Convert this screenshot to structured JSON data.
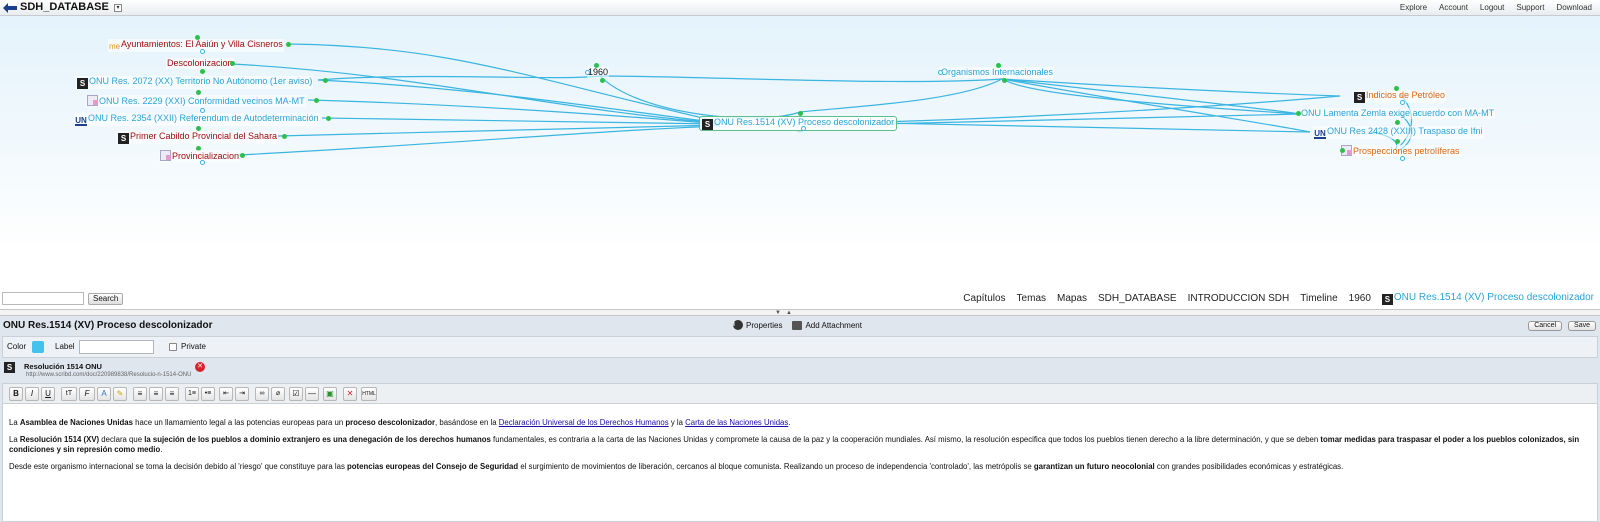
{
  "app": {
    "title": "SDH_DATABASE",
    "dropdown_glyph": "▾"
  },
  "topnav": [
    "Explore",
    "Account",
    "Logout",
    "Support",
    "Download"
  ],
  "graph": {
    "nodes": {
      "ayuntamientos": {
        "prefix": "me",
        "label": "Ayuntamientos: El Aaiún y Villa Cisneros"
      },
      "descolonizacion": {
        "label": "Descolonizacion"
      },
      "onu2072": {
        "label": "ONU Res. 2072 (XX) Territorio No Autónomo (1er aviso)"
      },
      "onu2229": {
        "label": "ONU Res. 2229 (XXI) Conformidad vecinos MA-MT"
      },
      "onu2354": {
        "label": "ONU Res. 2354 (XXII) Referendum de Autodeterminación"
      },
      "cabildo": {
        "label": "Primer Cabildo Provincial del Sahara"
      },
      "provincializacion": {
        "label": "Provincializacion"
      },
      "y1960": {
        "label": "1960"
      },
      "organismos": {
        "label": "Organismos Internacionales"
      },
      "center": {
        "label": "ONU Res.1514 (XV) Proceso descolonizador"
      },
      "indicios": {
        "label": "Indicios de Petróleo"
      },
      "lamenta": {
        "label": "ONU Lamenta Zemla exige acuerdo con MA-MT"
      },
      "onu2428": {
        "label": "ONU Res 2428 (XXIII) Traspaso de Ifni"
      },
      "prospecciones": {
        "label": "Prospecciones petrolíferas"
      }
    }
  },
  "search": {
    "placeholder": "",
    "button": "Search"
  },
  "breadcrumbs": [
    "Capítulos",
    "Temas",
    "Mapas",
    "SDH_DATABASE",
    "INTRODUCCION SDH",
    "Timeline",
    "1960",
    "ONU Res.1514 (XV) Proceso descolonizador"
  ],
  "panel": {
    "title": "ONU Res.1514 (XV) Proceso descolonizador",
    "tabs": {
      "properties": "Properties",
      "attachment": "Add Attachment"
    },
    "cancel": "Cancel",
    "save": "Save",
    "color_label": "Color",
    "color_value": "#44c1ec",
    "label_label": "Label",
    "label_value": "",
    "private_label": "Private"
  },
  "attachment": {
    "title": "Resolución 1514 ONU",
    "url": "http://www.scribd.com/doc/220989838/Resolucio-n-1514-ONU"
  },
  "editor_toolbar": [
    "bold",
    "italic",
    "underline",
    "font-size",
    "font-family",
    "text-color",
    "highlight",
    "align-left",
    "align-center",
    "align-right",
    "ordered-list",
    "unordered-list",
    "outdent",
    "indent",
    "link",
    "unlink",
    "checkbox",
    "horizontal-rule",
    "image",
    "remove",
    "html"
  ],
  "editor": {
    "p1": {
      "t1": "La ",
      "b1": "Asamblea de Naciones Unidas",
      "t2": " hace un llamamiento legal a las potencias europeas para un ",
      "b2": "proceso descolonizador",
      "t3": ", basándose en la ",
      "link1": "Declaración Universal de los Derechos Humanos",
      "t4": " y la ",
      "link2": "Carta de las Naciones Unidas",
      "t5": "."
    },
    "p2": {
      "t1": "La ",
      "b1": "Resolución 1514 (XV)",
      "t2": " declara que ",
      "b2": "la sujeción de los pueblos a dominio extranjero es una denegación de los derechos humanos",
      "t3": " fundamentales, es contraria a la carta de las Naciones Unidas y compromete la causa de la paz y la cooperación mundiales. Así mismo, la resolución especifica que todos los pueblos tienen derecho a la libre determinación, y que se deben ",
      "b3": "tomar medidas para traspasar el poder a los pueblos colonizados, sin condiciones y sin represión como medio",
      "t4": "."
    },
    "p3": {
      "t1": "Desde este organismo internacional se toma la decisión debido al 'riesgo' que constituye para las ",
      "b1": "potencias europeas del Consejo de Seguridad",
      "t2": " el surgimiento de movimientos de liberación, cercanos al bloque comunista. Realizando un proceso de independencia 'controlado', las metrópolis se ",
      "b2": "garantizan un futuro neocolonial",
      "t3": " con grandes posibilidades económicas y estratégicas."
    }
  }
}
